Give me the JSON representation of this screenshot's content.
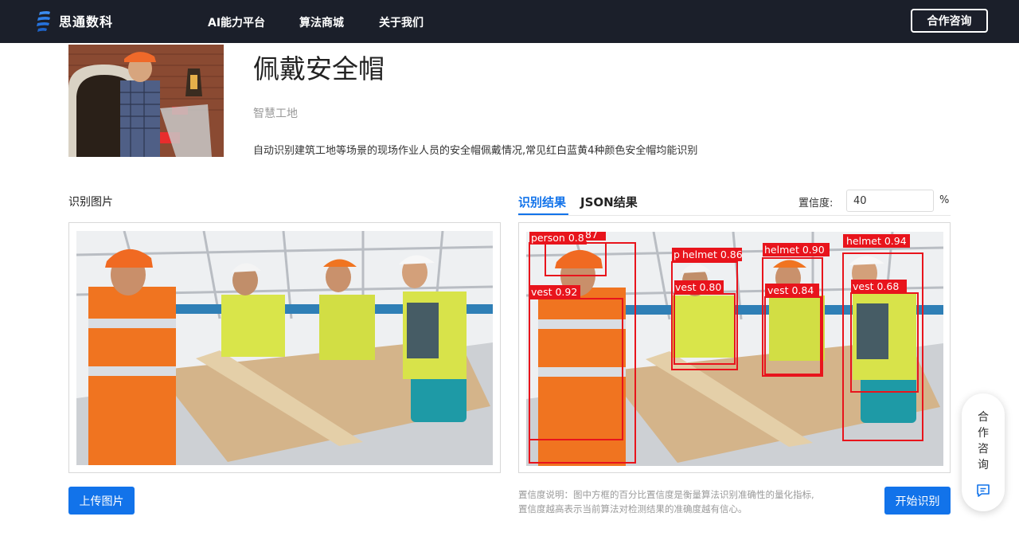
{
  "nav": {
    "brand": "思通数科",
    "links": [
      "AI能力平台",
      "算法商城",
      "关于我们"
    ],
    "cta": "合作咨询"
  },
  "header": {
    "title": "佩戴安全帽",
    "subtitle": "智慧工地",
    "description": "自动识别建筑工地等场景的现场作业人员的安全帽佩戴情况,常见红白蓝黄4种颜色安全帽均能识别"
  },
  "left": {
    "label": "识别图片",
    "upload": "上传图片"
  },
  "right": {
    "tabs": [
      "识别结果",
      "JSON结果"
    ],
    "confidence_label": "置信度:",
    "confidence_value": "40",
    "confidence_unit": "%",
    "note_line1": "置信度说明：图中方框的百分比置信度是衡量算法识别准确性的量化指标,",
    "note_line2": "置信度越高表示当前算法对检测结果的准确度越有信心。",
    "start": "开始识别"
  },
  "detections": [
    {
      "label": "person 0.87"
    },
    {
      "label": "87"
    },
    {
      "label": "vest 0.92"
    },
    {
      "label": "helmet 0.86"
    },
    {
      "label": "p"
    },
    {
      "label": "vest 0.80"
    },
    {
      "label": "helmet 0.90"
    },
    {
      "label": "vest 0.84"
    },
    {
      "label": "helmet 0.94"
    },
    {
      "label": "vest 0.68"
    }
  ],
  "float": {
    "text": "合作咨询"
  },
  "colors": {
    "nav_bg": "#1b1f2a",
    "primary": "#1273ea",
    "detection": "#e8141c"
  }
}
